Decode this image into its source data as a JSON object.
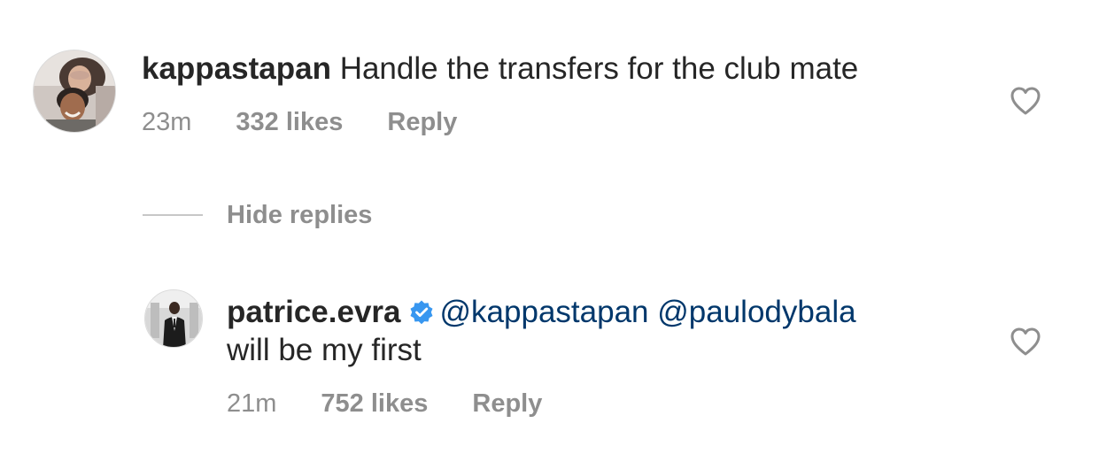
{
  "comments": [
    {
      "username": "kappastapan",
      "text": " Handle the transfers for the club mate",
      "time": "23m",
      "likes": "332 likes",
      "reply_label": "Reply",
      "liked": false
    },
    {
      "username": "patrice.evra",
      "verified": true,
      "mention_1": "@kappastapan",
      "mention_2": "@paulodybala",
      "text_line2": "will be my first",
      "time": "21m",
      "likes": "752 likes",
      "reply_label": "Reply",
      "liked": false
    }
  ],
  "thread": {
    "hide_replies_label": "Hide replies"
  },
  "icons": {
    "like": "heart-outline-icon",
    "verified": "verified-badge-icon"
  },
  "colors": {
    "text": "#262626",
    "secondary": "#8e8e8e",
    "mention": "#00376b",
    "verified": "#3897f0"
  }
}
